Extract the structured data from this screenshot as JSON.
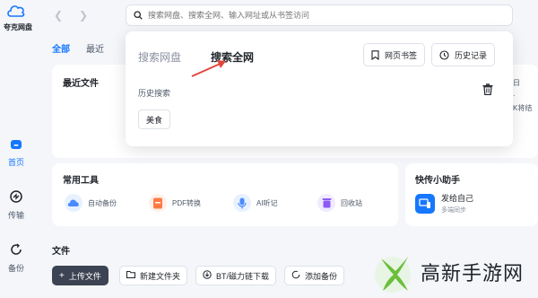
{
  "app": {
    "logo_text": "夸克网盘"
  },
  "rail": {
    "items": [
      {
        "label": "首页",
        "icon": "home-icon",
        "active": true
      },
      {
        "label": "传输",
        "icon": "transfer-icon",
        "active": false
      },
      {
        "label": "备份",
        "icon": "backup-icon",
        "active": false
      }
    ]
  },
  "search": {
    "placeholder": "搜索网盘、搜索全网、输入网址或从书签访问"
  },
  "tabs": [
    {
      "label": "全部"
    },
    {
      "label": "最近"
    }
  ],
  "recent": {
    "title": "最近文件"
  },
  "tools": {
    "title": "常用工具",
    "items": [
      {
        "label": "自动备份",
        "icon": "auto-backup-icon",
        "color": "#4a8cff"
      },
      {
        "label": "PDF转换",
        "icon": "pdf-icon",
        "color": "#ff7a45"
      },
      {
        "label": "AI听记",
        "icon": "ai-mic-icon",
        "color": "#4a8cff"
      },
      {
        "label": "回收站",
        "icon": "recycle-bin-icon",
        "color": "#8b5cf6"
      }
    ]
  },
  "assistant": {
    "title": "快传小助手",
    "name": "发给自己",
    "sub": "多端同步"
  },
  "right_clip": {
    "line1": "日",
    "line2": "·",
    "line3": "K将结"
  },
  "files": {
    "title": "文件",
    "buttons": [
      {
        "label": "上传文件",
        "icon": "plus-icon"
      },
      {
        "label": "新建文件夹",
        "icon": "new-folder-icon"
      },
      {
        "label": "BT/磁力链下载",
        "icon": "link-icon"
      },
      {
        "label": "添加备份",
        "icon": "backup-add-icon"
      }
    ]
  },
  "popup": {
    "tab_inactive": "搜索网盘",
    "tab_active": "搜索全网",
    "bookmark": "网页书签",
    "history": "历史记录",
    "history_label": "历史搜索",
    "chips": [
      "美食"
    ]
  },
  "watermark": {
    "text": "高新手游网"
  },
  "colors": {
    "accent": "#1677ff",
    "primary_button": "#3c4453",
    "arrow": "#e0463a"
  }
}
